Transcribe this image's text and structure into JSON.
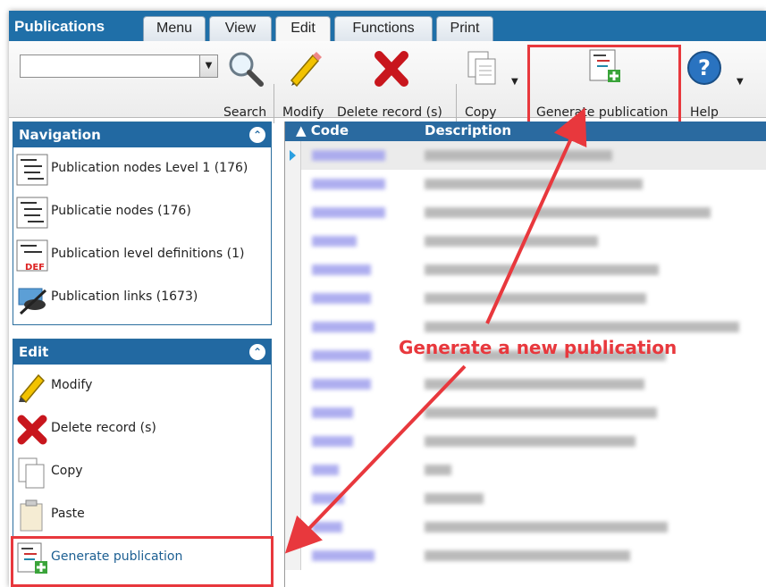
{
  "app": {
    "title": "Publications"
  },
  "tabs": [
    {
      "label": "Menu"
    },
    {
      "label": "View"
    },
    {
      "label": "Edit",
      "active": true
    },
    {
      "label": "Functions"
    },
    {
      "label": "Print"
    }
  ],
  "ribbon": {
    "search_combo_value": "",
    "search_label": "Search",
    "modify_label": "Modify",
    "delete_label": "Delete record (s)",
    "copy_label": "Copy",
    "generate_label": "Generate publication",
    "help_label": "Help"
  },
  "navigation": {
    "title": "Navigation",
    "items": [
      {
        "label": "Publication nodes Level 1 (176)",
        "icon": "tree-icon"
      },
      {
        "label": "Publicatie nodes (176)",
        "icon": "tree-icon"
      },
      {
        "label": "Publication level definitions (1)",
        "icon": "tree-def-icon"
      },
      {
        "label": "Publication links (1673)",
        "icon": "link-icon"
      }
    ]
  },
  "edit_panel": {
    "title": "Edit",
    "items": [
      {
        "label": "Modify",
        "icon": "pencil-icon"
      },
      {
        "label": "Delete record (s)",
        "icon": "delete-x-icon"
      },
      {
        "label": "Copy",
        "icon": "copy-icon"
      },
      {
        "label": "Paste",
        "icon": "paste-icon"
      },
      {
        "label": "Generate publication",
        "icon": "generate-publication-icon"
      }
    ]
  },
  "grid": {
    "columns": [
      {
        "label": "Code",
        "sorted": "ascending"
      },
      {
        "label": "Description"
      }
    ],
    "row_count_visible": 15
  },
  "annotation": {
    "text": "Generate a new publication",
    "color": "#e8383d"
  },
  "colors": {
    "accent": "#1f6fa8",
    "highlight": "#e8383d",
    "panel_head": "#2269a2"
  }
}
